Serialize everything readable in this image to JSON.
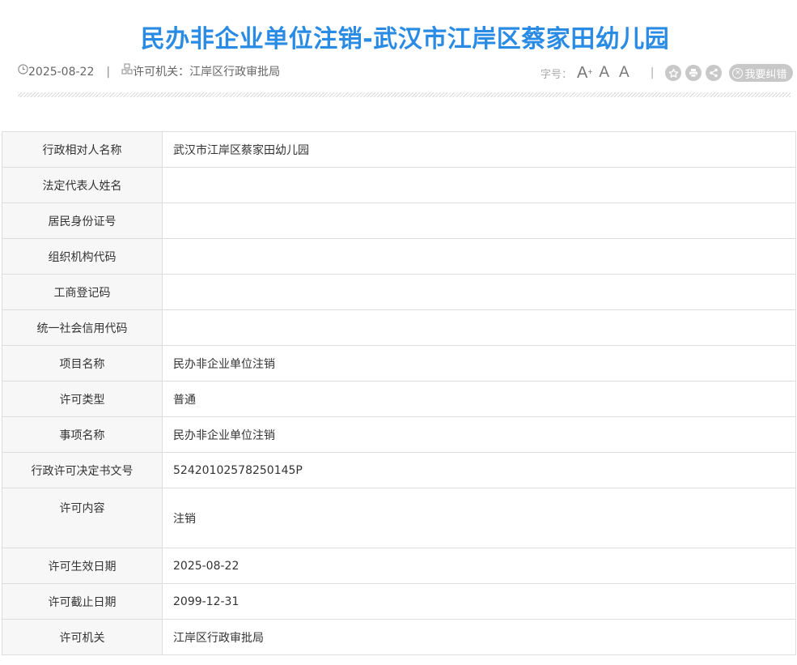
{
  "title": "民办非企业单位注销-武汉市江岸区蔡家田幼儿园",
  "meta": {
    "date": "2025-08-22",
    "separator": "|",
    "authority": "许可机关：江岸区行政审批局"
  },
  "toolbar": {
    "font_label": "字号：",
    "font_large": "A",
    "font_large_plus": "+",
    "font_medium": "A",
    "font_small": "A",
    "separator": "|",
    "report_label": "我要纠错",
    "icons": [
      "star-icon",
      "print-icon",
      "share-icon",
      "close-circle-icon"
    ]
  },
  "fields": [
    {
      "label": "行政相对人名称",
      "value": "武汉市江岸区蔡家田幼儿园"
    },
    {
      "label": "法定代表人姓名",
      "value": ""
    },
    {
      "label": "居民身份证号",
      "value": ""
    },
    {
      "label": "组织机构代码",
      "value": ""
    },
    {
      "label": "工商登记码",
      "value": ""
    },
    {
      "label": "统一社会信用代码",
      "value": ""
    },
    {
      "label": "项目名称",
      "value": "民办非企业单位注销"
    },
    {
      "label": "许可类型",
      "value": "普通"
    },
    {
      "label": "事项名称",
      "value": "民办非企业单位注销"
    },
    {
      "label": "行政许可决定书文号",
      "value": "52420102578250145P"
    },
    {
      "label": "许可内容",
      "value": "注销"
    },
    {
      "label": "许可生效日期",
      "value": "2025-08-22"
    },
    {
      "label": "许可截止日期",
      "value": "2099-12-31"
    },
    {
      "label": "许可机关",
      "value": "江岸区行政审批局"
    }
  ]
}
